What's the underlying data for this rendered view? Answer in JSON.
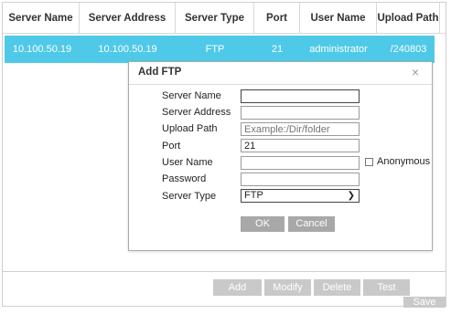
{
  "table": {
    "columns": [
      "Server Name",
      "Server Address",
      "Server Type",
      "Port",
      "User Name",
      "Upload Path"
    ],
    "rows": [
      [
        "10.100.50.19",
        "10.100.50.19",
        "FTP",
        "21",
        "administrator",
        "/240803"
      ]
    ],
    "selected_row_color": "#4fc9e8"
  },
  "dialog": {
    "title": "Add FTP",
    "close_icon": "×",
    "fields": {
      "server_name": {
        "label": "Server Name",
        "value": ""
      },
      "server_address": {
        "label": "Server Address",
        "value": ""
      },
      "upload_path": {
        "label": "Upload Path",
        "value": "",
        "placeholder": "Example:/Dir/folder"
      },
      "port": {
        "label": "Port",
        "value": "21"
      },
      "user_name": {
        "label": "User Name",
        "value": ""
      },
      "password": {
        "label": "Password",
        "value": ""
      },
      "server_type": {
        "label": "Server Type",
        "value": "FTP"
      }
    },
    "anonymous_label": "Anonymous",
    "ok_label": "OK",
    "cancel_label": "Cancel"
  },
  "toolbar": {
    "add_label": "Add",
    "modify_label": "Modify",
    "delete_label": "Delete",
    "test_label": "Test",
    "save_label": "Save"
  },
  "colors": {
    "accent": "#4fc9e8",
    "dialog_button": "#a8a8a8",
    "toolbar_button": "#c9c9c9"
  }
}
